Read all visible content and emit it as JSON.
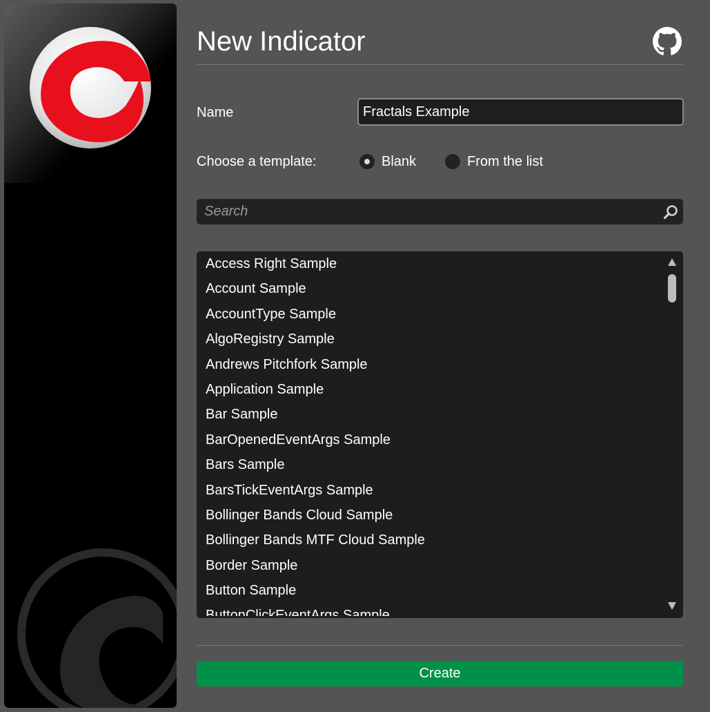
{
  "window": {
    "title": "New Indicator"
  },
  "banner": {
    "logo_icon": "cbot-logo-icon",
    "watermark_icon": "cbot-watermark-icon",
    "logo_color": "#e8101d"
  },
  "header": {
    "title": "New Indicator",
    "github_icon": "github-icon"
  },
  "form": {
    "name_label": "Name",
    "name_value": "Fractals Example",
    "template_label": "Choose a template:",
    "template_options": [
      {
        "label": "Blank",
        "checked": true
      },
      {
        "label": "From the list",
        "checked": false
      }
    ]
  },
  "search": {
    "placeholder": "Search",
    "icon": "search-icon"
  },
  "template_list": {
    "items": [
      "Access Right Sample",
      "Account Sample",
      "AccountType Sample",
      "AlgoRegistry Sample",
      "Andrews Pitchfork Sample",
      "Application Sample",
      "Bar Sample",
      "BarOpenedEventArgs Sample",
      "Bars Sample",
      "BarsTickEventArgs Sample",
      "Bollinger Bands Cloud Sample",
      "Bollinger Bands MTF Cloud Sample",
      "Border Sample",
      "Button Sample",
      "ButtonClickEventArgs Sample"
    ],
    "scroll_up_icon": "triangle-up-icon",
    "scroll_down_icon": "triangle-down-icon"
  },
  "actions": {
    "create_label": "Create",
    "create_color": "#009148"
  }
}
